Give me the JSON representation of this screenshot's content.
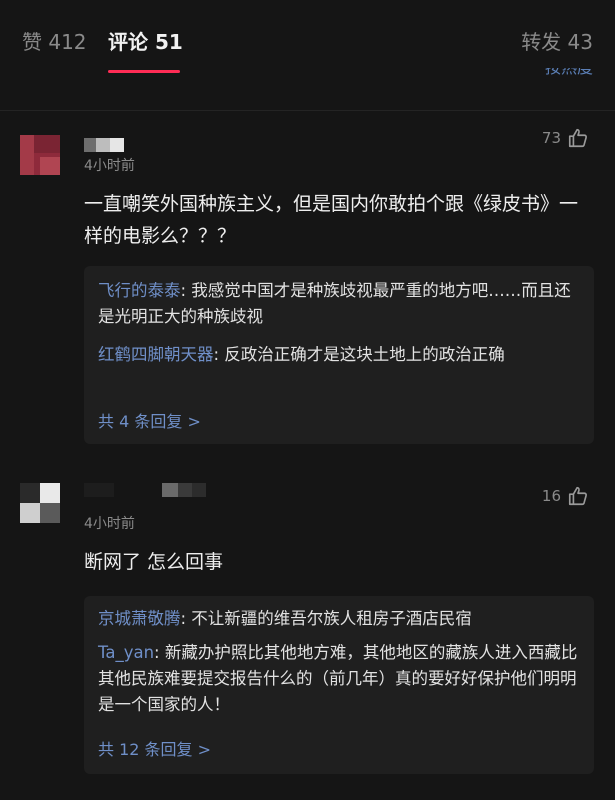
{
  "tabs": [
    {
      "label": "赞 412"
    },
    {
      "label": "评论 51"
    },
    {
      "label": "转发 43"
    }
  ],
  "sort_label": "按热度",
  "colors": {
    "accent": "#fe2c55",
    "link": "#6f8fc8"
  },
  "icons": {
    "like": "thumbs-up-icon"
  },
  "comments": [
    {
      "time": "4小时前",
      "likes": "73",
      "text": "一直嘲笑外国种族主义，但是国内你敢拍个跟《绿皮书》一样的电影么？？？",
      "replies": [
        {
          "author": "飞行的泰泰",
          "text": ": 我感觉中国才是种族歧视最严重的地方吧……而且还是光明正大的种族歧视"
        },
        {
          "author": "红鹤四脚朝天器",
          "text": ": 反政治正确才是这块土地上的政治正确"
        }
      ],
      "more_label": "共 4 条回复 >"
    },
    {
      "time": "4小时前",
      "likes": "16",
      "text": "断网了 怎么回事",
      "replies": [
        {
          "author": "京城萧敬腾",
          "text": ": 不让新疆的维吾尔族人租房子酒店民宿"
        },
        {
          "author": "Ta_yan",
          "text": ": 新藏办护照比其他地方难，其他地区的藏族人进入西藏比其他民族难要提交报告什么的（前几年）真的要好好保护他们明明是一个国家的人！"
        }
      ],
      "more_label": "共 12 条回复 >"
    }
  ]
}
